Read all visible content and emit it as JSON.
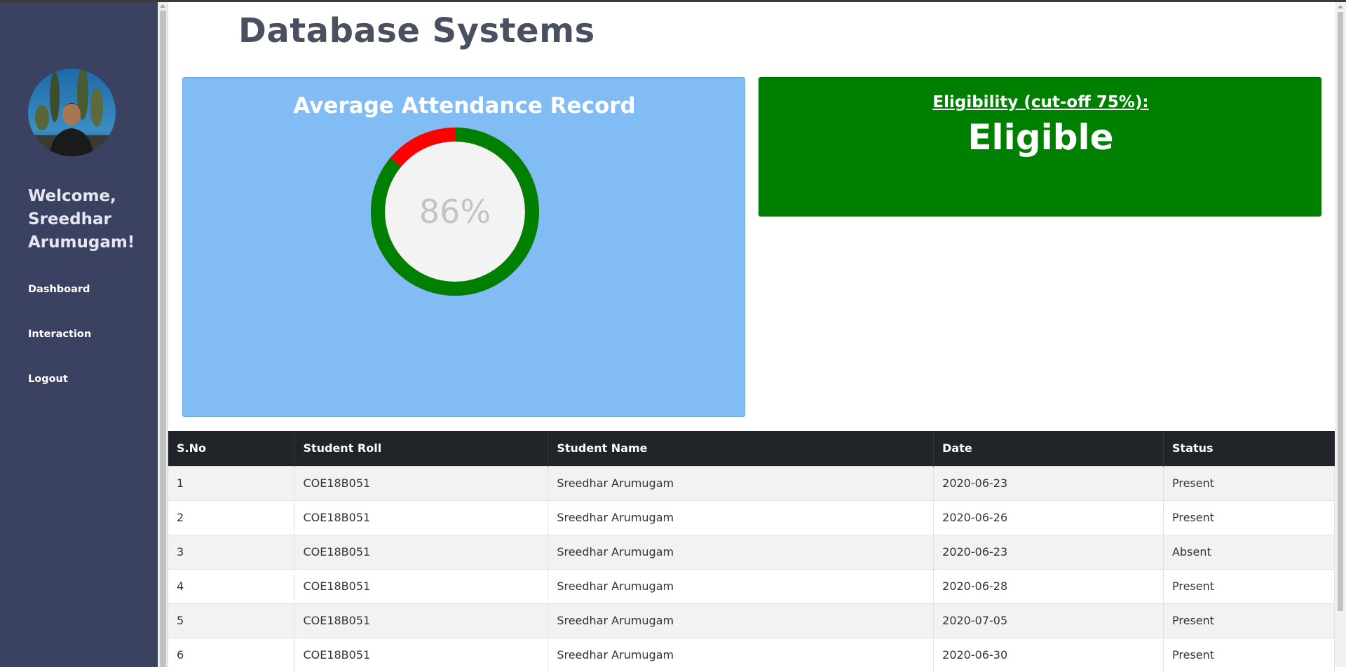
{
  "page_title": "Database Systems",
  "sidebar": {
    "welcome": "Welcome, Sreedhar Arumugam!",
    "nav": {
      "dashboard": "Dashboard",
      "interaction": "Interaction",
      "logout": "Logout"
    }
  },
  "attendance": {
    "title": "Average Attendance Record",
    "percent_label": "86%",
    "percent_value": 86,
    "present_color": "#008000",
    "absent_color": "#ff0000"
  },
  "eligibility": {
    "label": "Eligibility (cut-off 75%):",
    "value": "Eligible",
    "color": "#008000"
  },
  "table": {
    "headers": {
      "sno": "S.No",
      "roll": "Student Roll",
      "name": "Student Name",
      "date": "Date",
      "status": "Status"
    },
    "rows": [
      {
        "sno": "1",
        "roll": "COE18B051",
        "name": "Sreedhar Arumugam",
        "date": "2020-06-23",
        "status": "Present"
      },
      {
        "sno": "2",
        "roll": "COE18B051",
        "name": "Sreedhar Arumugam",
        "date": "2020-06-26",
        "status": "Present"
      },
      {
        "sno": "3",
        "roll": "COE18B051",
        "name": "Sreedhar Arumugam",
        "date": "2020-06-23",
        "status": "Absent"
      },
      {
        "sno": "4",
        "roll": "COE18B051",
        "name": "Sreedhar Arumugam",
        "date": "2020-06-28",
        "status": "Present"
      },
      {
        "sno": "5",
        "roll": "COE18B051",
        "name": "Sreedhar Arumugam",
        "date": "2020-07-05",
        "status": "Present"
      },
      {
        "sno": "6",
        "roll": "COE18B051",
        "name": "Sreedhar Arumugam",
        "date": "2020-06-30",
        "status": "Present"
      }
    ]
  }
}
